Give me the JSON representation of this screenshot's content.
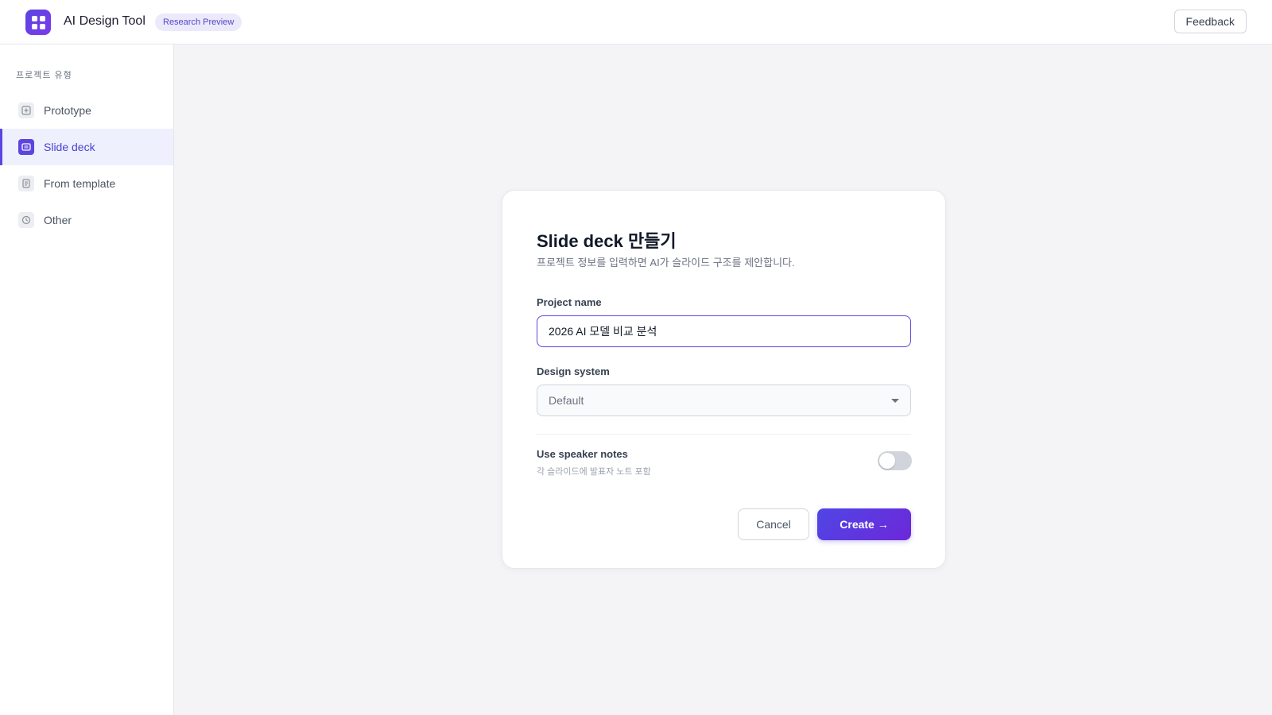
{
  "header": {
    "app_title": "AI Design Tool",
    "badge": "Research Preview",
    "feedback_label": "Feedback",
    "logo_icon": "grid-icon",
    "accent_color": "#5b45e0"
  },
  "sidebar": {
    "heading": "프로젝트 유형",
    "items": [
      {
        "label": "Prototype",
        "icon": "plus-square-icon",
        "active": false
      },
      {
        "label": "Slide deck",
        "icon": "slides-icon",
        "active": true
      },
      {
        "label": "From template",
        "icon": "document-icon",
        "active": false
      },
      {
        "label": "Other",
        "icon": "clock-icon",
        "active": false
      }
    ]
  },
  "dialog": {
    "title": "Slide deck 만들기",
    "subtitle": "프로젝트 정보를 입력하면 AI가 슬라이드 구조를 제안합니다.",
    "project_name_label": "Project name",
    "project_name_value": "2026 AI 모델 비교 분석",
    "design_system_label": "Design system",
    "design_system_value": "Default",
    "speaker_notes_title": "Use speaker notes",
    "speaker_notes_desc": "각 슬라이드에 발표자 노트 포함",
    "speaker_notes_enabled": false,
    "cancel_label": "Cancel",
    "create_label": "Create →"
  }
}
